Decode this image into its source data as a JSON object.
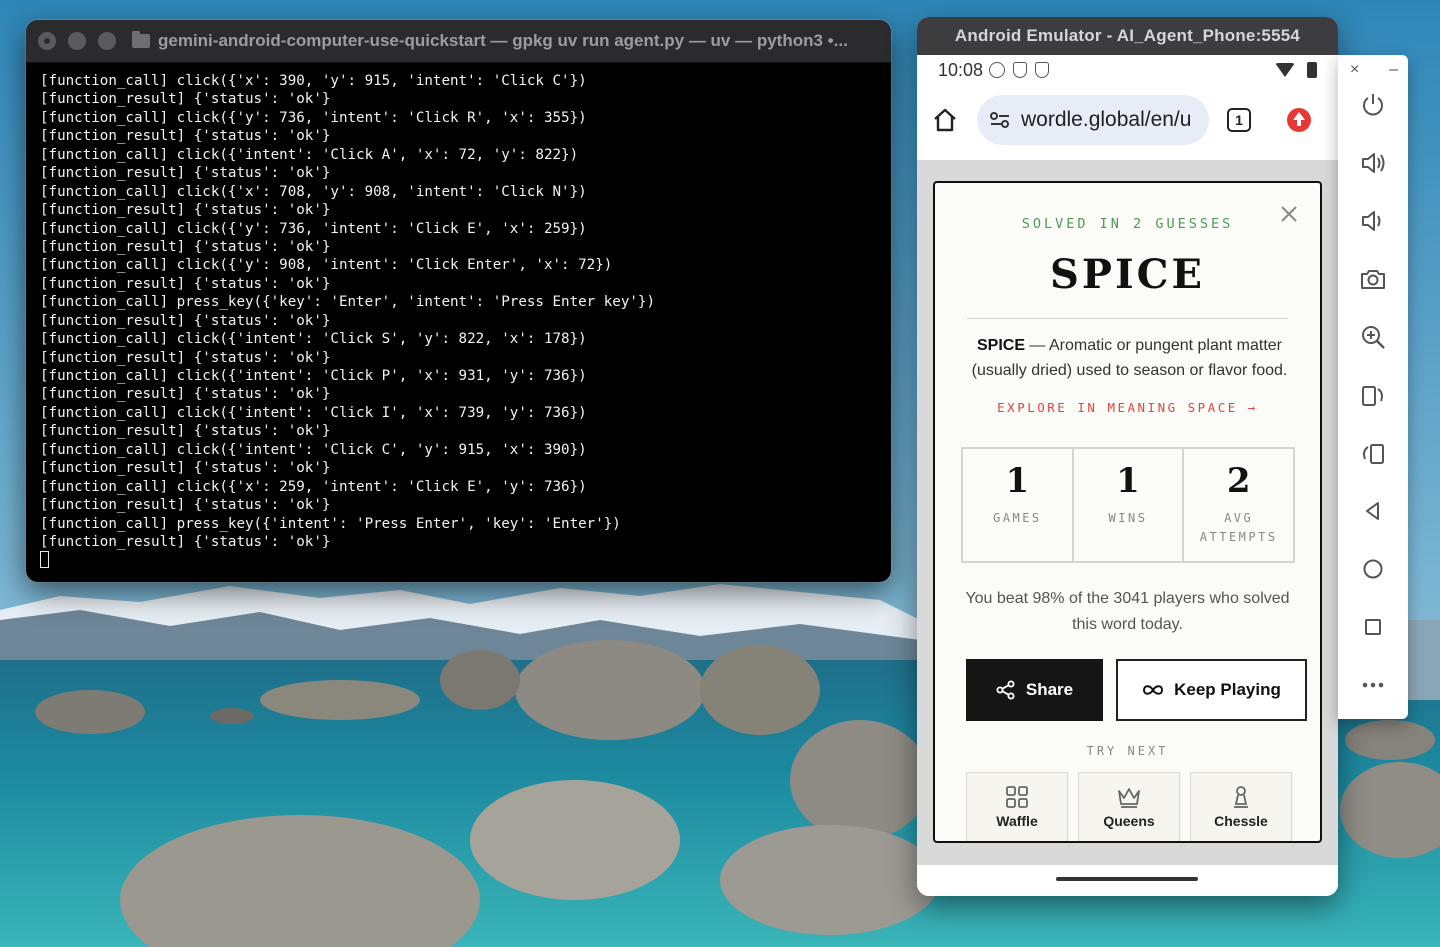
{
  "terminal": {
    "title": "gemini-android-computer-use-quickstart — gpkg uv run agent.py — uv — python3 •...",
    "lines": [
      "[function_call] click({'x': 390, 'y': 915, 'intent': 'Click C'})",
      "[function_result] {'status': 'ok'}",
      "[function_call] click({'y': 736, 'intent': 'Click R', 'x': 355})",
      "[function_result] {'status': 'ok'}",
      "[function_call] click({'intent': 'Click A', 'x': 72, 'y': 822})",
      "[function_result] {'status': 'ok'}",
      "[function_call] click({'x': 708, 'y': 908, 'intent': 'Click N'})",
      "[function_result] {'status': 'ok'}",
      "[function_call] click({'y': 736, 'intent': 'Click E', 'x': 259})",
      "[function_result] {'status': 'ok'}",
      "[function_call] click({'y': 908, 'intent': 'Click Enter', 'x': 72})",
      "[function_result] {'status': 'ok'}",
      "[function_call] press_key({'key': 'Enter', 'intent': 'Press Enter key'})",
      "[function_result] {'status': 'ok'}",
      "[function_call] click({'intent': 'Click S', 'y': 822, 'x': 178})",
      "[function_result] {'status': 'ok'}",
      "[function_call] click({'intent': 'Click P', 'x': 931, 'y': 736})",
      "[function_result] {'status': 'ok'}",
      "[function_call] click({'intent': 'Click I', 'x': 739, 'y': 736})",
      "[function_result] {'status': 'ok'}",
      "[function_call] click({'intent': 'Click C', 'y': 915, 'x': 390})",
      "[function_result] {'status': 'ok'}",
      "[function_call] click({'x': 259, 'intent': 'Click E', 'y': 736})",
      "[function_result] {'status': 'ok'}",
      "[function_call] press_key({'intent': 'Press Enter', 'key': 'Enter'})",
      "[function_result] {'status': 'ok'}"
    ]
  },
  "emulator": {
    "title": "Android Emulator - AI_Agent_Phone:5554",
    "status_time": "10:08",
    "url": "wordle.global/en/u",
    "tab_count": "1"
  },
  "modal": {
    "solved_label": "SOLVED IN 2 GUESSES",
    "word": "SPICE",
    "definition_word": "SPICE",
    "definition_dash": " — ",
    "definition_text": "Aromatic or pungent plant matter (usually dried) used to season or flavor food.",
    "explore_link": "EXPLORE IN MEANING SPACE →",
    "stats": [
      {
        "value": "1",
        "label": "GAMES"
      },
      {
        "value": "1",
        "label": "WINS"
      },
      {
        "value": "2",
        "label": "AVG ATTEMPTS"
      }
    ],
    "beat_text": "You beat 98% of the 3041 players who solved this word today.",
    "share_label": "Share",
    "keep_playing_label": "Keep Playing",
    "try_next_label": "TRY NEXT",
    "games": [
      {
        "name": "Waffle",
        "icon": "grid-icon"
      },
      {
        "name": "Queens",
        "icon": "crown-icon"
      },
      {
        "name": "Chessle",
        "icon": "chess-pawn-icon"
      }
    ]
  },
  "toolbar": {
    "close_glyph": "×",
    "minimize_glyph": "–",
    "buttons": [
      "power-icon",
      "volume-up-icon",
      "volume-down-icon",
      "camera-icon",
      "zoom-icon",
      "rotate-left-icon",
      "rotate-right-icon",
      "back-icon",
      "home-icon",
      "overview-icon",
      "more-icon"
    ]
  },
  "colors": {
    "solved_green": "#4e9b55",
    "explore_red": "#e0463f",
    "share_bg": "#151515"
  }
}
